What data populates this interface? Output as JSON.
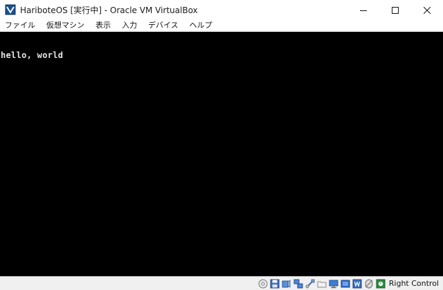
{
  "window": {
    "title": "HariboteOS [実行中] - Oracle VM VirtualBox",
    "app_icon": "virtualbox-icon",
    "controls": {
      "minimize_icon": "minimize-icon",
      "maximize_icon": "maximize-icon",
      "close_icon": "close-icon"
    }
  },
  "menubar": {
    "items": [
      {
        "label": "ファイル"
      },
      {
        "label": "仮想マシン"
      },
      {
        "label": "表示"
      },
      {
        "label": "入力"
      },
      {
        "label": "デバイス"
      },
      {
        "label": "ヘルプ"
      }
    ]
  },
  "screen": {
    "console_text": "hello, world",
    "background": "#000000",
    "text_color": "#e6e6e6"
  },
  "statusbar": {
    "icons": [
      "optical-drive-icon",
      "floppy-icon",
      "audio-icon",
      "network-icon",
      "usb-icon",
      "shared-folders-icon",
      "display-icon",
      "video-capture-icon",
      "virtualization-icon",
      "mouse-integration-icon",
      "keyboard-capture-icon"
    ],
    "host_key": "Right Control"
  }
}
